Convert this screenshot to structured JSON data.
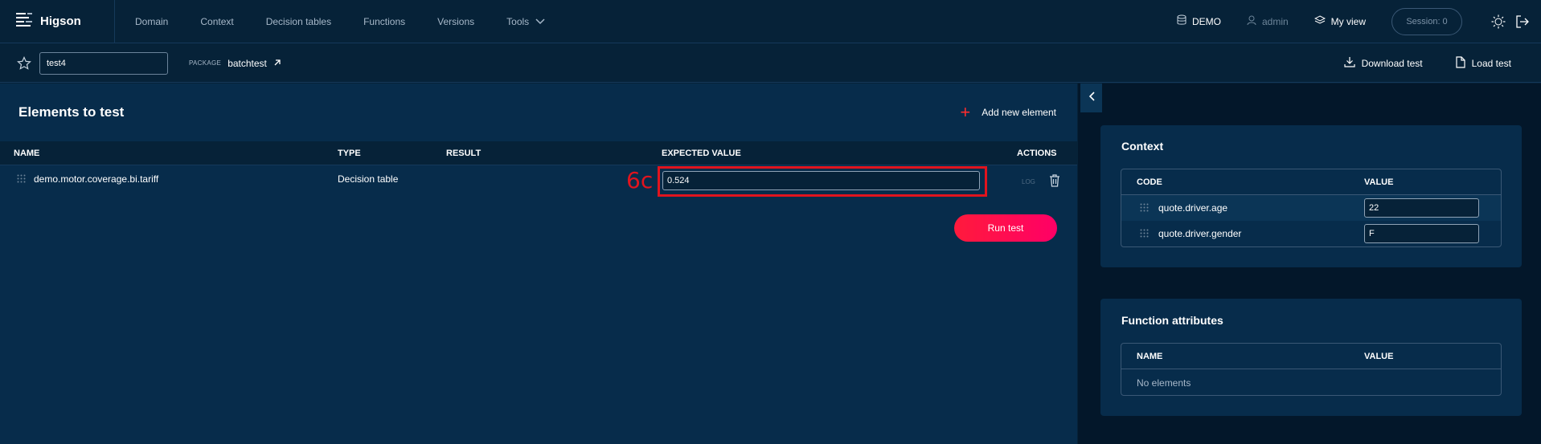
{
  "brand": {
    "name": "Higson"
  },
  "nav": {
    "items": [
      "Domain",
      "Context",
      "Decision tables",
      "Functions",
      "Versions"
    ],
    "tools_label": "Tools"
  },
  "topbar_right": {
    "env": "DEMO",
    "user": "admin",
    "view": "My view",
    "session": "Session: 0"
  },
  "subbar": {
    "test_name": "test4",
    "package_label": "PACKAGE",
    "package_value": "batchtest",
    "download": "Download test",
    "load": "Load test"
  },
  "main": {
    "title": "Elements to test",
    "add_label": "Add new element",
    "columns": {
      "name": "NAME",
      "type": "TYPE",
      "result": "RESULT",
      "expected": "EXPECTED VALUE",
      "actions": "ACTIONS"
    },
    "row": {
      "name": "demo.motor.coverage.bi.tariff",
      "type": "Decision table",
      "result": "",
      "expected_value": "0.524",
      "log_label": "LOG"
    },
    "annotation": "6c",
    "run_label": "Run test"
  },
  "context": {
    "title": "Context",
    "columns": {
      "code": "CODE",
      "value": "VALUE"
    },
    "rows": [
      {
        "code": "quote.driver.age",
        "value": "22"
      },
      {
        "code": "quote.driver.gender",
        "value": "F"
      }
    ]
  },
  "function_attributes": {
    "title": "Function attributes",
    "columns": {
      "name": "NAME",
      "value": "VALUE"
    },
    "empty": "No elements"
  },
  "colors": {
    "accent": "#ff1a3c",
    "background": "#062238",
    "panel": "#072c4b",
    "highlight": "#e0141e"
  }
}
